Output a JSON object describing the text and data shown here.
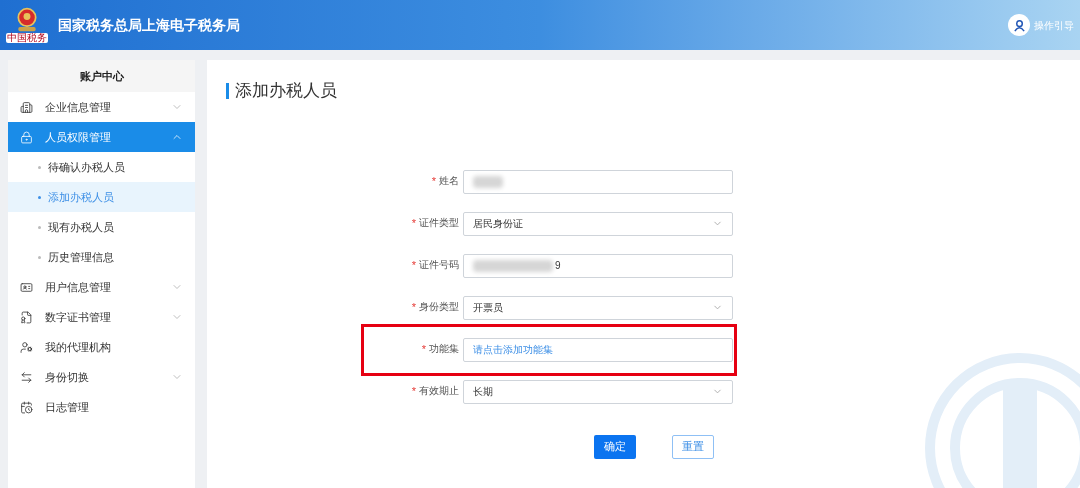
{
  "header": {
    "title": "国家税务总局上海电子税务局",
    "logo_caption": "中国税务",
    "guide": "操作引导"
  },
  "sidebar": {
    "title": "账户中心",
    "items": [
      {
        "label": "企业信息管理",
        "expanded": false,
        "selected": false
      },
      {
        "label": "人员权限管理",
        "expanded": true,
        "selected": true,
        "children": [
          {
            "label": "待确认办税人员",
            "selected": false
          },
          {
            "label": "添加办税人员",
            "selected": true
          },
          {
            "label": "现有办税人员",
            "selected": false
          },
          {
            "label": "历史管理信息",
            "selected": false
          }
        ]
      },
      {
        "label": "用户信息管理",
        "expanded": false,
        "selected": false
      },
      {
        "label": "数字证书管理",
        "expanded": false,
        "selected": false
      },
      {
        "label": "我的代理机构",
        "selected": false
      },
      {
        "label": "身份切换",
        "expanded": false,
        "selected": false
      },
      {
        "label": "日志管理",
        "selected": false
      }
    ]
  },
  "page_title": "添加办税人员",
  "form": [
    {
      "label": "姓名",
      "kind": "text",
      "required_mark": "*",
      "blurred": true,
      "highlighted": false
    },
    {
      "label": "证件类型",
      "kind": "select",
      "required_mark": "*",
      "value": "居民身份证",
      "highlighted": false
    },
    {
      "label": "证件号码",
      "kind": "text",
      "required_mark": "*",
      "blurred": true,
      "value": "9",
      "highlighted": false
    },
    {
      "label": "身份类型",
      "kind": "select",
      "required_mark": "*",
      "value": "开票员",
      "highlighted": false
    },
    {
      "label": "功能集",
      "kind": "link",
      "required_mark": "*",
      "placeholder": "请点击添加功能集",
      "highlighted": true
    },
    {
      "label": "有效期止",
      "kind": "select",
      "required_mark": "*",
      "value": "长期",
      "highlighted": false
    }
  ],
  "buttons": [
    {
      "label": "确定",
      "primary": true
    },
    {
      "label": "重置",
      "primary": false
    }
  ]
}
